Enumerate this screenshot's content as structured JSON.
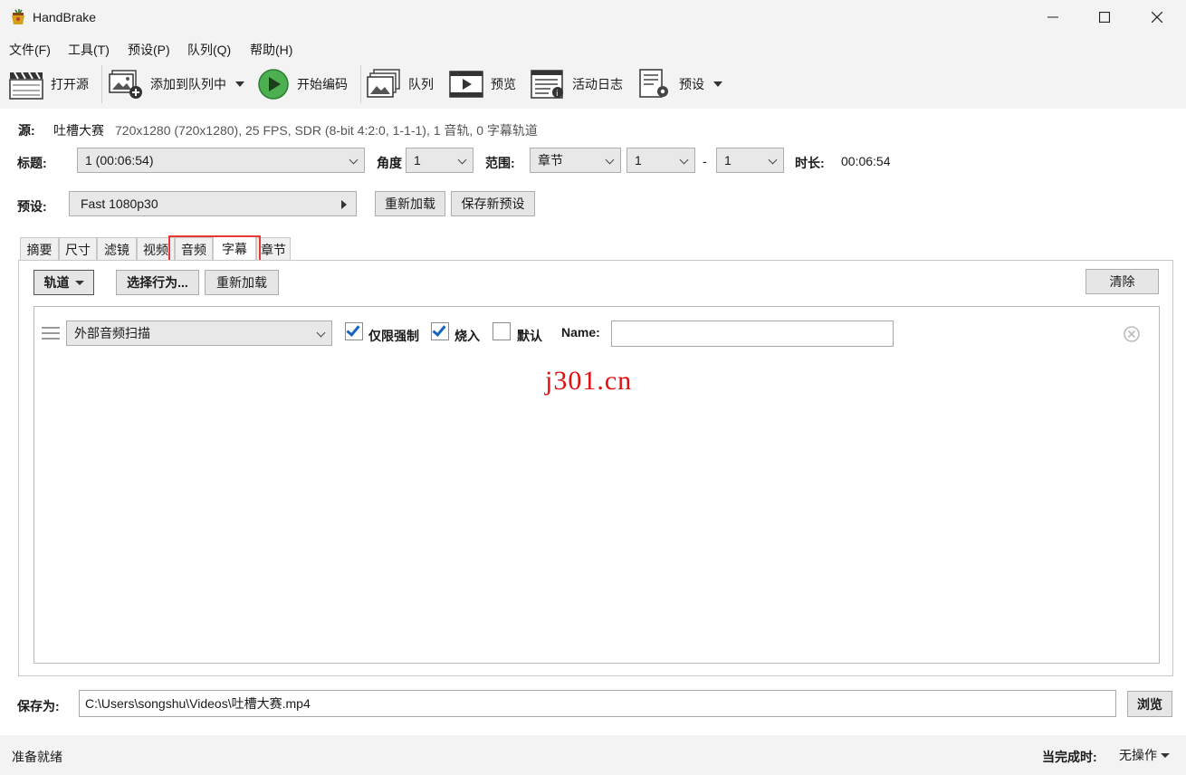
{
  "window": {
    "title": "HandBrake"
  },
  "menu": [
    {
      "label": "文件(F)"
    },
    {
      "label": "工具(T)"
    },
    {
      "label": "预设(P)"
    },
    {
      "label": "队列(Q)"
    },
    {
      "label": "帮助(H)"
    }
  ],
  "toolbar": {
    "open_source": "打开源",
    "add_to_queue": "添加到队列中",
    "start_encode": "开始编码",
    "queue": "队列",
    "preview": "预览",
    "activity_log": "活动日志",
    "presets": "预设"
  },
  "source": {
    "label": "源:",
    "name": "吐槽大赛",
    "info": "720x1280 (720x1280), 25 FPS, SDR (8-bit 4:2:0, 1-1-1), 1 音轨, 0 字幕轨道"
  },
  "title_row": {
    "title_label": "标题:",
    "title_value": "1  (00:06:54)",
    "angle_label": "角度",
    "angle_value": "1",
    "range_label": "范围:",
    "range_type": "章节",
    "range_start": "1",
    "range_dash": "-",
    "range_end": "1",
    "duration_label": "时长:",
    "duration_value": "00:06:54"
  },
  "preset_row": {
    "label": "预设:",
    "value": "Fast 1080p30",
    "reload": "重新加载",
    "save_new": "保存新预设"
  },
  "tabs": [
    {
      "label": "摘要"
    },
    {
      "label": "尺寸"
    },
    {
      "label": "滤镜"
    },
    {
      "label": "视频"
    },
    {
      "label": "音频"
    },
    {
      "label": "字幕"
    },
    {
      "label": "章节"
    }
  ],
  "subtitles": {
    "tracks_btn": "轨道",
    "select_behavior": "选择行为...",
    "reload": "重新加载",
    "clear": "清除",
    "track": {
      "source": "外部音频扫描",
      "forced_only": "仅限强制",
      "forced_only_checked": true,
      "burn_in": "烧入",
      "burn_in_checked": true,
      "default": "默认",
      "default_checked": false,
      "name_label": "Name:",
      "name_value": ""
    }
  },
  "watermark": "j301.cn",
  "save": {
    "label": "保存为:",
    "path": "C:\\Users\\songshu\\Videos\\吐槽大赛.mp4",
    "browse": "浏览"
  },
  "status": {
    "text": "准备就绪",
    "when_done_label": "当完成时:",
    "when_done_value": "无操作"
  }
}
